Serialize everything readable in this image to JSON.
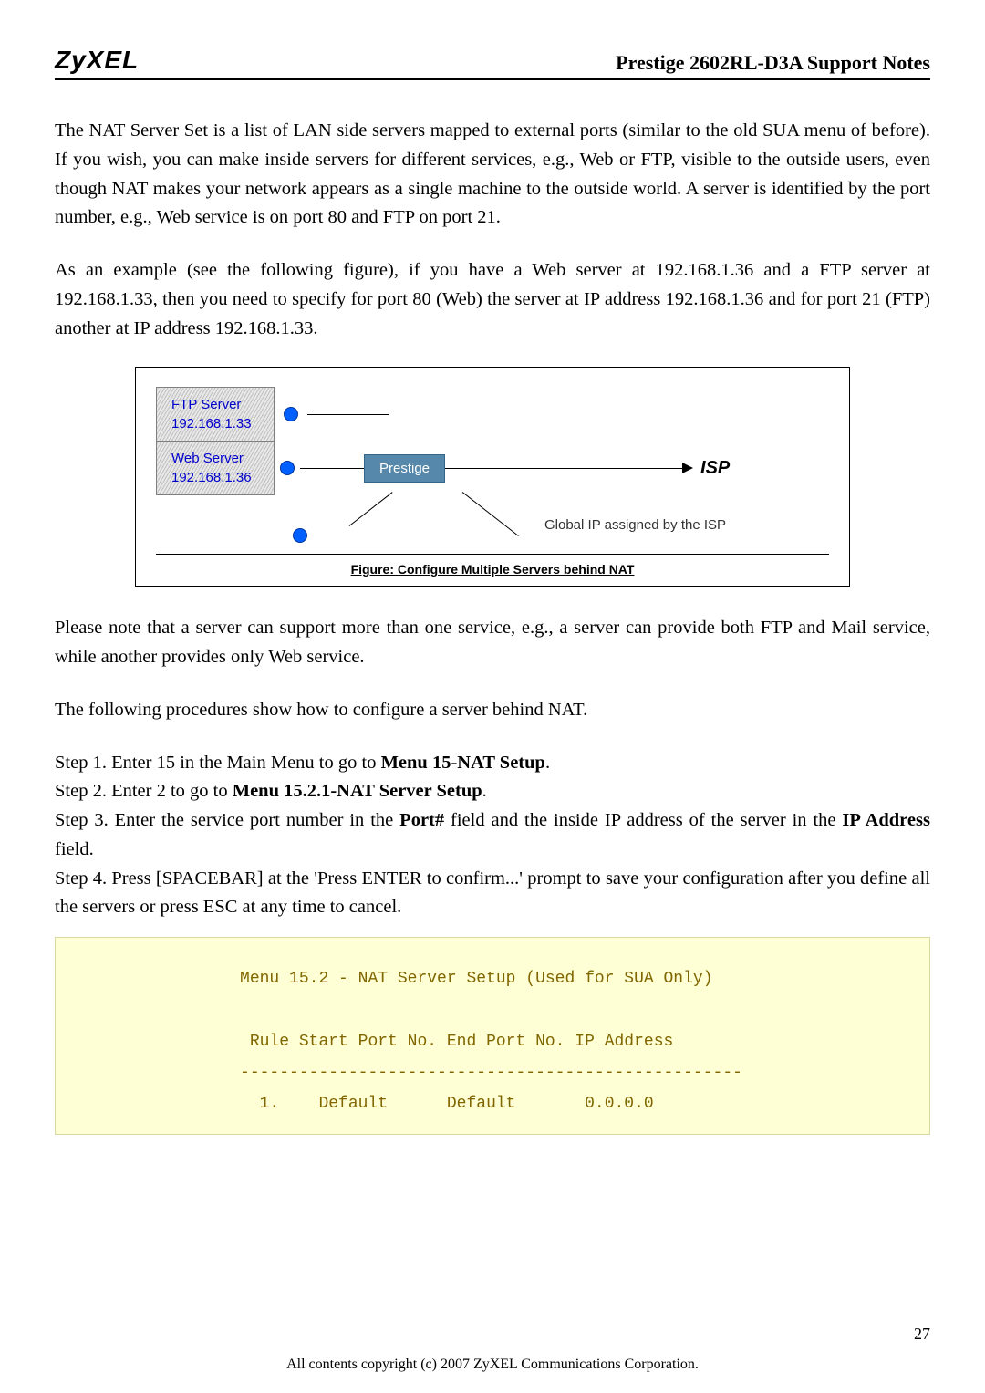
{
  "header": {
    "logo": "ZyXEL",
    "title": "Prestige 2602RL-D3A Support Notes"
  },
  "para1": "The NAT Server Set is a list of LAN side servers mapped to external ports (similar to the old SUA menu of before). If you wish, you can make inside servers for different services, e.g., Web or FTP, visible to the outside users, even though NAT makes your network appears as a single machine to the outside world. A server is identified by the port number, e.g., Web service is on port 80 and FTP on port 21.",
  "para2": "As an example (see the following figure), if you have a Web server at 192.168.1.36 and a FTP server at 192.168.1.33, then you need to specify for port 80 (Web) the server at IP address 192.168.1.36 and for port 21 (FTP) another at IP address 192.168.1.33.",
  "figure": {
    "ftp_label": "FTP Server",
    "ftp_ip": "192.168.1.33",
    "web_label": "Web Server",
    "web_ip": "192.168.1.36",
    "prestige": "Prestige",
    "isp": "ISP",
    "global_ip": "Global IP assigned by the ISP",
    "caption": "Figure: Configure Multiple Servers behind NAT"
  },
  "para3": "Please note that a server can support more than one service, e.g., a server can provide both FTP and Mail service, while another provides only Web service.",
  "para4": "The following procedures show how to configure a server behind NAT.",
  "steps": {
    "s1a": "Step 1. Enter 15 in the Main Menu to go to ",
    "s1b": "Menu 15-NAT Setup",
    "s1c": ".",
    "s2a": "Step 2. Enter 2 to go to ",
    "s2b": "Menu 15.2.1-NAT Server Setup",
    "s2c": ".",
    "s3a": "Step 3. Enter the service port number in the ",
    "s3b": "Port#",
    "s3c": " field and the inside IP address of the server in the ",
    "s3d": "IP Address",
    "s3e": " field.",
    "s4": "Step 4. Press [SPACEBAR] at the 'Press ENTER to confirm...' prompt to save your configuration after you define all the servers or press ESC at any time to cancel."
  },
  "code": "               Menu 15.2 - NAT Server Setup (Used for SUA Only)\n\n                Rule Start Port No. End Port No. IP Address\n               ---------------------------------------------------\n                 1.    Default      Default       0.0.0.0",
  "page_number": "27",
  "footer": "All contents copyright (c) 2007 ZyXEL Communications Corporation."
}
